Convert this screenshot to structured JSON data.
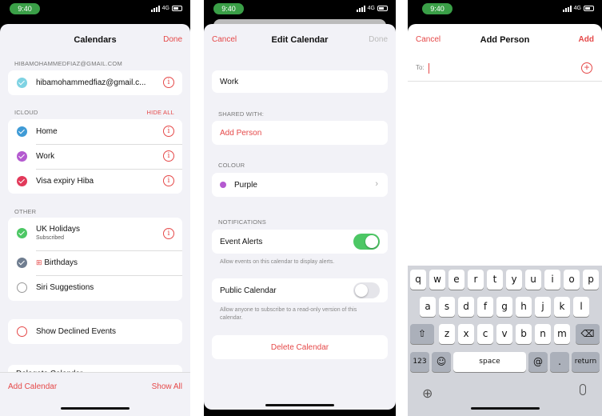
{
  "status": {
    "time": "9:40",
    "network": "4G"
  },
  "colors": {
    "accent": "#e54848",
    "home": "#3f9bd6",
    "work": "#b45ad0",
    "visa": "#e2395a",
    "uk": "#4cc764",
    "birthdays": "#6f7d90",
    "toggle_on": "#4cc764",
    "purple": "#b45ad0"
  },
  "screen1": {
    "title": "Calendars",
    "done": "Done",
    "account_header": "HIBAMOHAMMEDFIAZ@GMAIL.COM",
    "account_item": "hibamohammedfiaz@gmail.c...",
    "icloud_header": "ICLOUD",
    "hide_all": "HIDE ALL",
    "icloud_items": [
      "Home",
      "Work",
      "Visa expiry Hiba"
    ],
    "other_header": "OTHER",
    "uk_holidays": "UK Holidays",
    "uk_sub": "Subscribed",
    "birthdays": "Birthdays",
    "siri": "Siri Suggestions",
    "declined": "Show Declined Events",
    "partial": "Delegate Calendar",
    "add_calendar": "Add Calendar",
    "show_all": "Show All"
  },
  "screen2": {
    "cancel": "Cancel",
    "title": "Edit Calendar",
    "done": "Done",
    "name_value": "Work",
    "shared_header": "SHARED WITH:",
    "add_person": "Add Person",
    "colour_header": "COLOUR",
    "colour_value": "Purple",
    "notifications_header": "NOTIFICATIONS",
    "event_alerts": "Event Alerts",
    "event_alerts_on": true,
    "event_alerts_note": "Allow events on this calendar to display alerts.",
    "public_calendar": "Public Calendar",
    "public_calendar_on": false,
    "public_note": "Allow anyone to subscribe to a read-only version of this calendar.",
    "delete": "Delete Calendar"
  },
  "screen3": {
    "cancel": "Cancel",
    "title": "Add Person",
    "add": "Add",
    "to_label": "To:",
    "to_value": "",
    "keyboard": {
      "row1": [
        "q",
        "w",
        "e",
        "r",
        "t",
        "y",
        "u",
        "i",
        "o",
        "p"
      ],
      "row2": [
        "a",
        "s",
        "d",
        "f",
        "g",
        "h",
        "j",
        "k",
        "l"
      ],
      "row3": [
        "z",
        "x",
        "c",
        "v",
        "b",
        "n",
        "m"
      ],
      "k123": "123",
      "space": "space",
      "at": "@",
      "dot": ".",
      "return": "return"
    }
  }
}
